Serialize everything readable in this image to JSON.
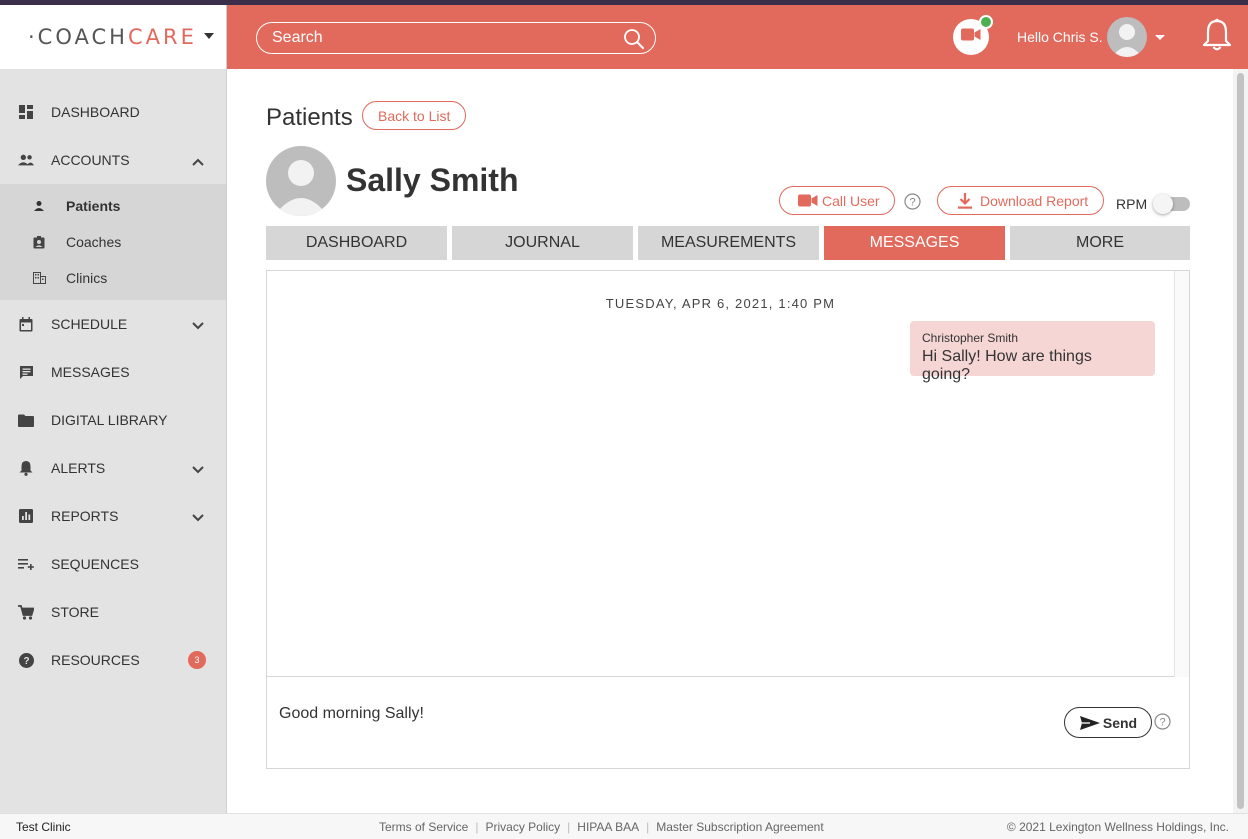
{
  "app": {
    "logo": {
      "part1": "·COACH",
      "part2": "CARE"
    }
  },
  "sidebar": {
    "items": [
      {
        "label": "DASHBOARD"
      },
      {
        "label": "ACCOUNTS"
      },
      {
        "label": "SCHEDULE"
      },
      {
        "label": "MESSAGES"
      },
      {
        "label": "DIGITAL LIBRARY"
      },
      {
        "label": "ALERTS"
      },
      {
        "label": "REPORTS"
      },
      {
        "label": "SEQUENCES"
      },
      {
        "label": "STORE"
      },
      {
        "label": "RESOURCES",
        "badge": "3"
      }
    ],
    "accounts_sub": [
      {
        "label": "Patients"
      },
      {
        "label": "Coaches"
      },
      {
        "label": "Clinics"
      }
    ]
  },
  "header": {
    "search_placeholder": "Search",
    "greeting": "Hello Chris S."
  },
  "page": {
    "title": "Patients",
    "back_label": "Back to List",
    "patient_name": "Sally Smith",
    "call_label": "Call User",
    "download_label": "Download Report",
    "rpm_label": "RPM",
    "rpm_enabled": false
  },
  "tabs": [
    {
      "label": "DASHBOARD"
    },
    {
      "label": "JOURNAL"
    },
    {
      "label": "MEASUREMENTS"
    },
    {
      "label": "MESSAGES",
      "active": true
    },
    {
      "label": "MORE"
    }
  ],
  "messages": {
    "date": "TUESDAY, APR 6, 2021, 1:40 PM",
    "thread": [
      {
        "sender": "Christopher Smith",
        "text": "Hi Sally! How are things going?"
      }
    ],
    "compose_value": "Good morning Sally!",
    "send_label": "Send"
  },
  "footer": {
    "clinic": "Test Clinic",
    "links": [
      "Terms of Service",
      "Privacy Policy",
      "HIPAA BAA",
      "Master Subscription Agreement"
    ],
    "copyright": "© 2021 Lexington Wellness Holdings, Inc."
  },
  "colors": {
    "brand": "#e26a5c",
    "sidebar_bg": "#e3e3e3",
    "bubble_bg": "#f6d6d4",
    "online": "#4caf50"
  }
}
